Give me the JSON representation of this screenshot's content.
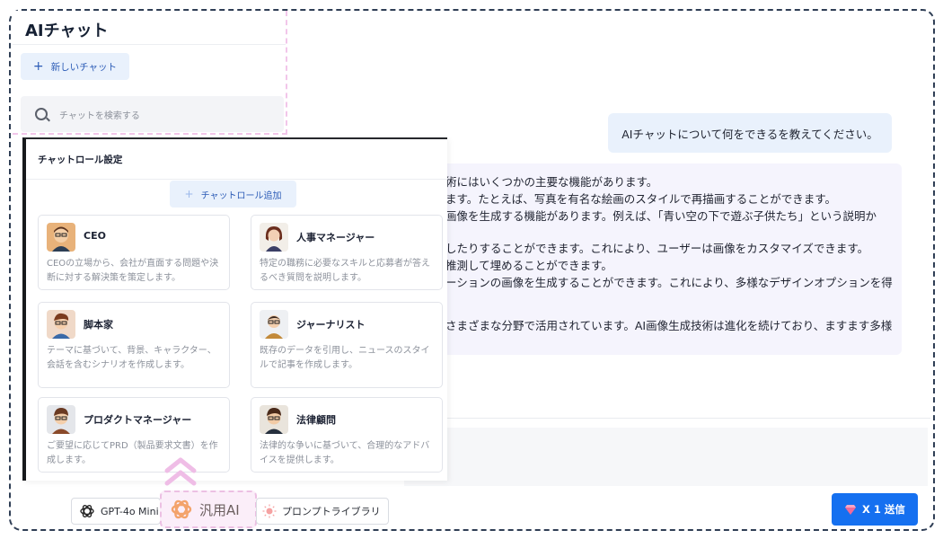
{
  "sidebar": {
    "app_title": "AIチャット",
    "new_chat_label": "新しいチャット",
    "search_placeholder": "チャットを検索する"
  },
  "chat": {
    "user_message": "AIチャットについて何をできるを教えてください。",
    "ai_response_lines": [
      "術にはいくつかの主要な機能があります。",
      "ます。たとえば、写真を有名な絵画のスタイルで再描画することができます。",
      "画像を生成する機能があります。例えば、「青い空の下で遊ぶ子供たち」という説明か",
      "したりすることができます。これにより、ユーザーは画像をカスタマイズできます。",
      "推測して埋めることができます。",
      "ーションの画像を生成することができます。これにより、多様なデザインオプションを得",
      "さまざまな分野で活用されています。AI画像生成技術は進化を続けており、ますます多様"
    ]
  },
  "role_panel": {
    "title": "チャットロール設定",
    "add_label": "チャットロール追加",
    "roles": [
      {
        "name": "CEO",
        "desc": "CEOの立場から、会社が直面する問題や決断に対する解決策を策定します。"
      },
      {
        "name": "人事マネージャー",
        "desc": "特定の職務に必要なスキルと応募者が答えるべき質問を説明します。"
      },
      {
        "name": "脚本家",
        "desc": "テーマに基づいて、背景、キャラクター、会話を含むシナリオを作成します。"
      },
      {
        "name": "ジャーナリスト",
        "desc": "既存のデータを引用し、ニュースのスタイルで記事を作成します。"
      },
      {
        "name": "プロダクトマネージャー",
        "desc": "ご要望に応じてPRD（製品要求文書）を作成します。"
      },
      {
        "name": "法律顧問",
        "desc": "法律的な争いに基づいて、合理的なアドバイスを提供します。"
      }
    ]
  },
  "bottom_bar": {
    "model_label": "GPT-4o Mini",
    "general_label": "汎用AI",
    "prompt_library_label": "プロンプトライブラリ",
    "send_label": "X 1 送信"
  },
  "colors": {
    "accent": "#1570f0",
    "user_bubble": "#e9f1fc",
    "ai_bubble": "#f5f4fd",
    "highlight": "#fbeef9"
  }
}
